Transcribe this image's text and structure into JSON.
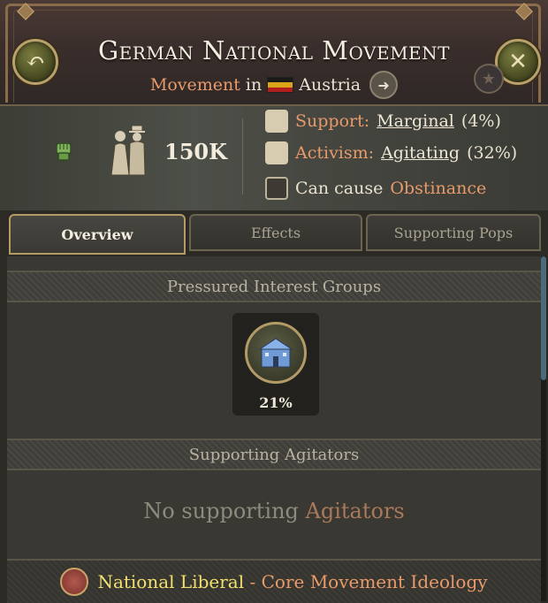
{
  "header": {
    "title": "German National Movement",
    "subtitle_type": "Movement",
    "subtitle_in": "in",
    "country": "Austria"
  },
  "stats": {
    "size": "150K",
    "support_label": "Support:",
    "support_value": "Marginal",
    "support_pct": "(4%)",
    "activism_label": "Activism:",
    "activism_value": "Agitating",
    "activism_pct": "(32%)",
    "cause_label": "Can cause",
    "cause_value": "Obstinance"
  },
  "tabs": [
    {
      "label": "Overview",
      "active": true
    },
    {
      "label": "Effects",
      "active": false
    },
    {
      "label": "Supporting Pops",
      "active": false
    }
  ],
  "sections": {
    "pressured_title": "Pressured Interest Groups",
    "agitators_title": "Supporting Agitators",
    "no_agitators_prefix": "No supporting",
    "no_agitators_word": "Agitators"
  },
  "interest_group": {
    "percent": "21%"
  },
  "ideology": {
    "name": "National Liberal",
    "separator": " - ",
    "type": "Core Movement Ideology"
  },
  "colors": {
    "accent": "#e89a6a",
    "ideology_name": "#f1e06e",
    "flag": [
      "#1a1a1a",
      "#d9a417",
      "#b01e1e"
    ]
  }
}
